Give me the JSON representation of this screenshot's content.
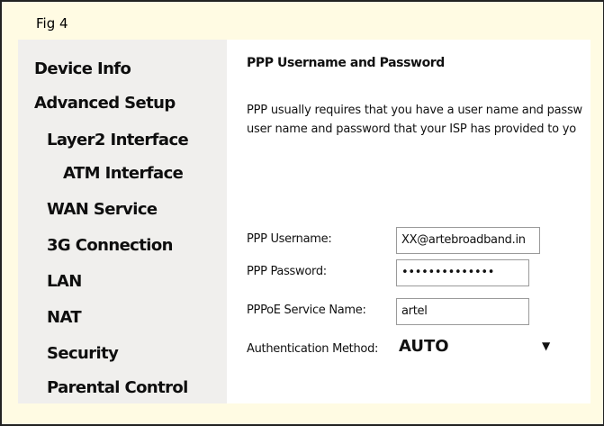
{
  "figure_label": "Fig 4",
  "sidebar": {
    "items": [
      {
        "label": "Device Info"
      },
      {
        "label": "Advanced Setup"
      },
      {
        "label": "Layer2 Interface"
      },
      {
        "label": "ATM Interface"
      },
      {
        "label": "WAN Service"
      },
      {
        "label": "3G Connection"
      },
      {
        "label": "LAN"
      },
      {
        "label": "NAT"
      },
      {
        "label": "Security"
      },
      {
        "label": "Parental Control"
      }
    ]
  },
  "main": {
    "title": "PPP Username and Password",
    "description": [
      "PPP usually requires that you have a user name and passw",
      "user name and password that your ISP has provided to yo"
    ],
    "fields": {
      "username": {
        "label": "PPP Username:",
        "value": "XX@artebroadband.in"
      },
      "password": {
        "label": "PPP Password:",
        "value": "••••••••••••••"
      },
      "service_name": {
        "label": "PPPoE Service Name:",
        "value": "artel"
      },
      "auth_method": {
        "label": "Authentication Method:",
        "value": "AUTO",
        "arrow": "▼"
      }
    }
  },
  "colors": {
    "page_background": "#fffbe3",
    "sidebar_background": "#f0efed",
    "content_background": "#ffffff"
  }
}
